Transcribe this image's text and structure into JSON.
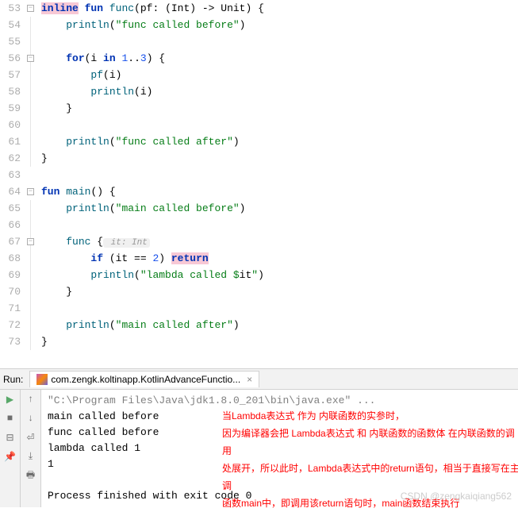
{
  "editor": {
    "lines": [
      {
        "num": "53",
        "fold": "minus"
      },
      {
        "num": "54"
      },
      {
        "num": "55"
      },
      {
        "num": "56",
        "fold": "minus"
      },
      {
        "num": "57"
      },
      {
        "num": "58"
      },
      {
        "num": "59"
      },
      {
        "num": "60"
      },
      {
        "num": "61"
      },
      {
        "num": "62"
      },
      {
        "num": "63"
      },
      {
        "num": "64",
        "fold": "minus",
        "run": true
      },
      {
        "num": "65"
      },
      {
        "num": "66"
      },
      {
        "num": "67",
        "fold": "minus"
      },
      {
        "num": "68"
      },
      {
        "num": "69"
      },
      {
        "num": "70"
      },
      {
        "num": "71"
      },
      {
        "num": "72"
      },
      {
        "num": "73"
      }
    ],
    "code": {
      "l53": {
        "kw1": "inline",
        "kw2": "fun",
        "fn": "func",
        "sig": "(pf: (Int) -> Unit) {"
      },
      "l54": {
        "fn": "println",
        "str": "\"func called before\"",
        "tail": ")"
      },
      "l56": {
        "kw": "for",
        "rest": "(i ",
        "kw2": "in",
        "rest2": " ",
        "n1": "1",
        "dots": "..",
        "n2": "3",
        "tail": ") {"
      },
      "l57": {
        "fn": "pf",
        "tail": "(i)"
      },
      "l58": {
        "fn": "println",
        "tail": "(i)"
      },
      "l59": {
        "brace": "}"
      },
      "l61": {
        "fn": "println",
        "str": "\"func called after\"",
        "tail": ")"
      },
      "l62": {
        "brace": "}"
      },
      "l64": {
        "kw": "fun",
        "fn": "main",
        "tail": "() {"
      },
      "l65": {
        "fn": "println",
        "str": "\"main called before\"",
        "tail": ")"
      },
      "l67": {
        "fn": "func",
        "brace": " {",
        "hint": " it: Int"
      },
      "l68": {
        "kw": "if",
        "mid": " (it == ",
        "num": "2",
        "close": ") ",
        "ret": "return"
      },
      "l69": {
        "fn": "println",
        "str": "\"lambda called $",
        "var": "it",
        "str2": "\"",
        "tail": ")"
      },
      "l70": {
        "brace": "}"
      },
      "l72": {
        "fn": "println",
        "str": "\"main called after\"",
        "tail": ")"
      },
      "l73": {
        "brace": "}"
      }
    }
  },
  "run": {
    "label": "Run:",
    "tab": "com.zengk.koltinapp.KotlinAdvanceFunctio...",
    "console": {
      "cmd": "\"C:\\Program Files\\Java\\jdk1.8.0_201\\bin\\java.exe\" ...",
      "out1": "main called before",
      "out2": "func called before",
      "out3": "lambda called 1",
      "out4": "1",
      "exit": "Process finished with exit code 0"
    },
    "annotation": {
      "l1": "当Lambda表达式 作为 内联函数的实参时，",
      "l2": "因为编译器会把 Lambda表达式 和 内联函数的函数体 在内联函数的调用",
      "l3": "处展开，所以此时，Lambda表达式中的return语句，相当于直接写在主调",
      "l4": "函数main中，即调用该return语句时，main函数结束执行"
    }
  },
  "watermark": "CSDN @zengkaiqiang562"
}
